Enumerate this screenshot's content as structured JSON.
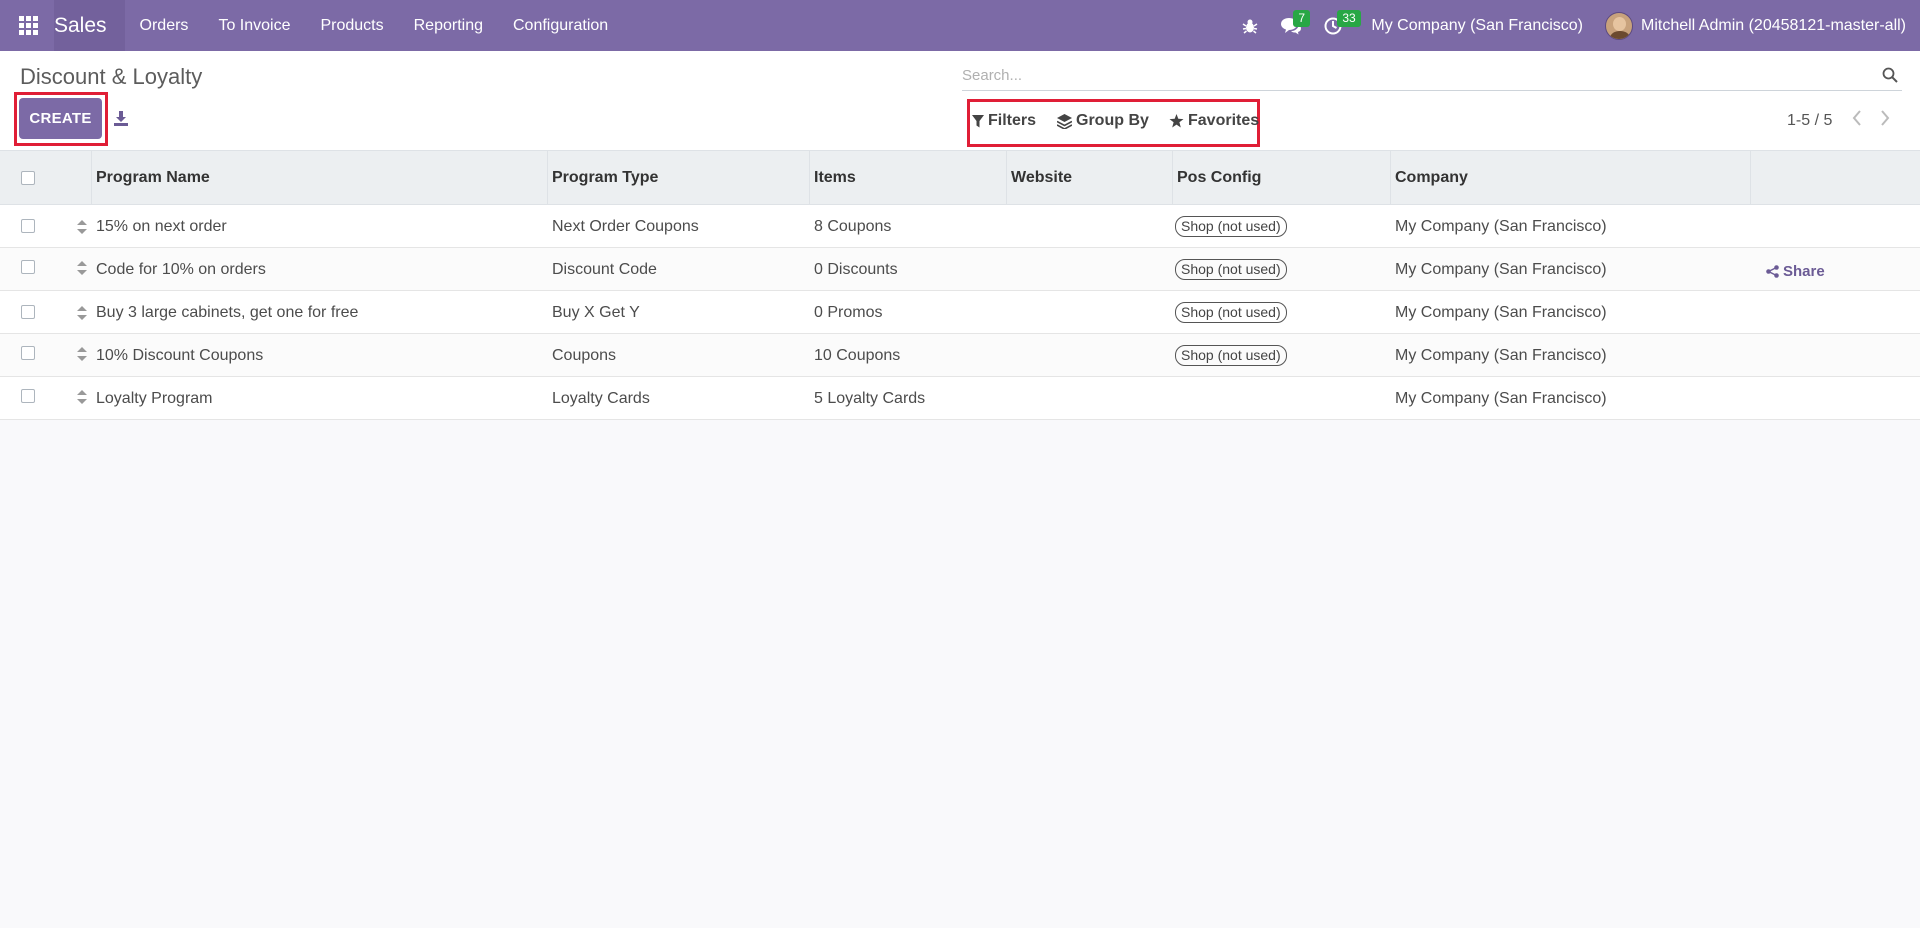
{
  "navbar": {
    "app_name": "Sales",
    "menu": [
      "Orders",
      "To Invoice",
      "Products",
      "Reporting",
      "Configuration"
    ],
    "messages_count": "7",
    "activities_count": "33",
    "company": "My Company (San Francisco)",
    "user": "Mitchell Admin (20458121-master-all)"
  },
  "control": {
    "breadcrumb": "Discount & Loyalty",
    "create_label": "CREATE",
    "search_placeholder": "Search...",
    "filters_label": "Filters",
    "group_by_label": "Group By",
    "favorites_label": "Favorites",
    "pager": "1-5 / 5"
  },
  "table": {
    "columns": [
      "Program Name",
      "Program Type",
      "Items",
      "Website",
      "Pos Config",
      "Company"
    ],
    "rows": [
      {
        "name": "15% on next order",
        "type": "Next Order Coupons",
        "items": "8 Coupons",
        "website": "",
        "pos": "Shop (not used)",
        "company": "My Company (San Francisco)",
        "action": ""
      },
      {
        "name": "Code for 10% on orders",
        "type": "Discount Code",
        "items": "0 Discounts",
        "website": "",
        "pos": "Shop (not used)",
        "company": "My Company (San Francisco)",
        "action": "Share"
      },
      {
        "name": "Buy 3 large cabinets, get one for free",
        "type": "Buy X Get Y",
        "items": "0 Promos",
        "website": "",
        "pos": "Shop (not used)",
        "company": "My Company (San Francisco)",
        "action": ""
      },
      {
        "name": "10% Discount Coupons",
        "type": "Coupons",
        "items": "10 Coupons",
        "website": "",
        "pos": "Shop (not used)",
        "company": "My Company (San Francisco)",
        "action": ""
      },
      {
        "name": "Loyalty Program",
        "type": "Loyalty Cards",
        "items": "5 Loyalty Cards",
        "website": "",
        "pos": "",
        "company": "My Company (San Francisco)",
        "action": ""
      }
    ]
  },
  "colors": {
    "brand": "#7c6aa6",
    "highlight": "#e01e36",
    "badge": "#28a745"
  },
  "icons": [
    "apps-grid-icon",
    "bug-icon",
    "chat-icon",
    "clock-icon",
    "download-icon",
    "search-icon",
    "filter-icon",
    "layers-icon",
    "star-icon",
    "sort-handle-icon",
    "share-icon",
    "chevron-left-icon",
    "chevron-right-icon"
  ]
}
